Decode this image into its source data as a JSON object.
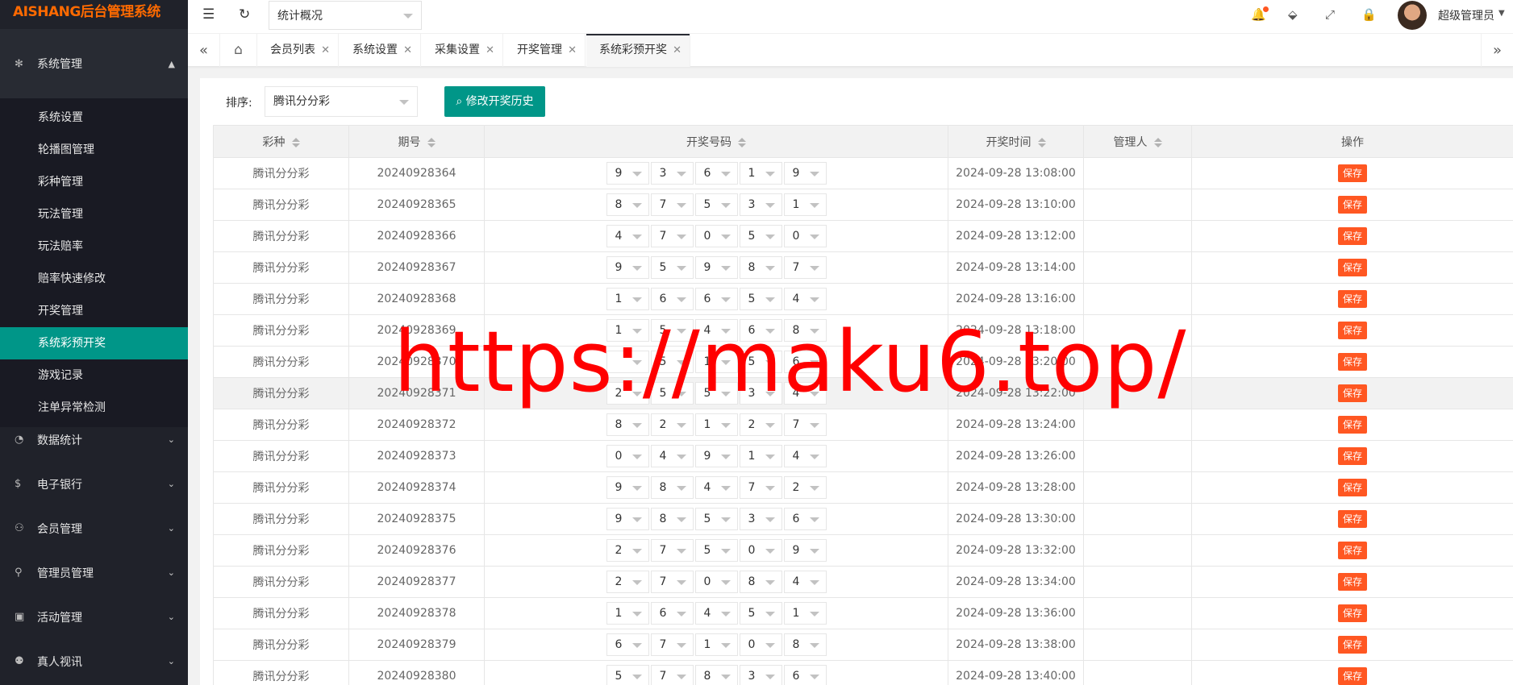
{
  "app": {
    "title": "AISHANG后台管理系统"
  },
  "topbar": {
    "select_value": "统计概况",
    "admin_name": "超级管理员"
  },
  "sidebar": {
    "open_group": {
      "label": "系统管理",
      "icon": "gear-icon"
    },
    "sub_items": [
      {
        "label": "系统设置"
      },
      {
        "label": "轮播图管理"
      },
      {
        "label": "彩种管理"
      },
      {
        "label": "玩法管理"
      },
      {
        "label": "玩法赔率"
      },
      {
        "label": "赔率快速修改"
      },
      {
        "label": "开奖管理"
      },
      {
        "label": "系统彩预开奖",
        "active": true
      },
      {
        "label": "游戏记录"
      },
      {
        "label": "注单异常检测"
      }
    ],
    "groups": [
      {
        "label": "数据统计",
        "icon": "dashboard-icon"
      },
      {
        "label": "电子银行",
        "icon": "dollar-icon"
      },
      {
        "label": "会员管理",
        "icon": "users-icon"
      },
      {
        "label": "管理员管理",
        "icon": "user-icon"
      },
      {
        "label": "活动管理",
        "icon": "gift-icon"
      },
      {
        "label": "真人视讯",
        "icon": "group-icon"
      }
    ]
  },
  "tabs": [
    {
      "label": "会员列表"
    },
    {
      "label": "系统设置"
    },
    {
      "label": "采集设置"
    },
    {
      "label": "开奖管理"
    },
    {
      "label": "系统彩预开奖",
      "active": true
    }
  ],
  "filter": {
    "label": "排序:",
    "select_value": "腾讯分分彩",
    "history_button": "修改开奖历史"
  },
  "table": {
    "headers": [
      "彩种",
      "期号",
      "开奖号码",
      "开奖时间",
      "管理人",
      "操作"
    ],
    "save_label": "保存",
    "rows": [
      {
        "game": "腾讯分分彩",
        "issue": "20240928364",
        "numbers": [
          "9",
          "3",
          "6",
          "1",
          "9"
        ],
        "time": "2024-09-28 13:08:00",
        "admin": ""
      },
      {
        "game": "腾讯分分彩",
        "issue": "20240928365",
        "numbers": [
          "8",
          "7",
          "5",
          "3",
          "1"
        ],
        "time": "2024-09-28 13:10:00",
        "admin": ""
      },
      {
        "game": "腾讯分分彩",
        "issue": "20240928366",
        "numbers": [
          "4",
          "7",
          "0",
          "5",
          "0"
        ],
        "time": "2024-09-28 13:12:00",
        "admin": ""
      },
      {
        "game": "腾讯分分彩",
        "issue": "20240928367",
        "numbers": [
          "9",
          "5",
          "9",
          "8",
          "7"
        ],
        "time": "2024-09-28 13:14:00",
        "admin": ""
      },
      {
        "game": "腾讯分分彩",
        "issue": "20240928368",
        "numbers": [
          "1",
          "6",
          "6",
          "5",
          "4"
        ],
        "time": "2024-09-28 13:16:00",
        "admin": ""
      },
      {
        "game": "腾讯分分彩",
        "issue": "20240928369",
        "numbers": [
          "1",
          "5",
          "4",
          "6",
          "8"
        ],
        "time": "2024-09-28 13:18:00",
        "admin": ""
      },
      {
        "game": "腾讯分分彩",
        "issue": "20240928370",
        "numbers": [
          "",
          "5",
          "1",
          "5",
          "6"
        ],
        "time": "2024-09-28 13:20:00",
        "admin": ""
      },
      {
        "game": "腾讯分分彩",
        "issue": "20240928371",
        "numbers": [
          "2",
          "5",
          "5",
          "3",
          "4"
        ],
        "time": "2024-09-28 13:22:00",
        "admin": "",
        "highlight": true
      },
      {
        "game": "腾讯分分彩",
        "issue": "20240928372",
        "numbers": [
          "8",
          "2",
          "1",
          "2",
          "7"
        ],
        "time": "2024-09-28 13:24:00",
        "admin": ""
      },
      {
        "game": "腾讯分分彩",
        "issue": "20240928373",
        "numbers": [
          "0",
          "4",
          "9",
          "1",
          "4"
        ],
        "time": "2024-09-28 13:26:00",
        "admin": ""
      },
      {
        "game": "腾讯分分彩",
        "issue": "20240928374",
        "numbers": [
          "9",
          "8",
          "4",
          "7",
          "2"
        ],
        "time": "2024-09-28 13:28:00",
        "admin": ""
      },
      {
        "game": "腾讯分分彩",
        "issue": "20240928375",
        "numbers": [
          "9",
          "8",
          "5",
          "3",
          "6"
        ],
        "time": "2024-09-28 13:30:00",
        "admin": ""
      },
      {
        "game": "腾讯分分彩",
        "issue": "20240928376",
        "numbers": [
          "2",
          "7",
          "5",
          "0",
          "9"
        ],
        "time": "2024-09-28 13:32:00",
        "admin": ""
      },
      {
        "game": "腾讯分分彩",
        "issue": "20240928377",
        "numbers": [
          "2",
          "7",
          "0",
          "8",
          "4"
        ],
        "time": "2024-09-28 13:34:00",
        "admin": ""
      },
      {
        "game": "腾讯分分彩",
        "issue": "20240928378",
        "numbers": [
          "1",
          "6",
          "4",
          "5",
          "1"
        ],
        "time": "2024-09-28 13:36:00",
        "admin": ""
      },
      {
        "game": "腾讯分分彩",
        "issue": "20240928379",
        "numbers": [
          "6",
          "7",
          "1",
          "0",
          "8"
        ],
        "time": "2024-09-28 13:38:00",
        "admin": ""
      },
      {
        "game": "腾讯分分彩",
        "issue": "20240928380",
        "numbers": [
          "5",
          "7",
          "8",
          "3",
          "6"
        ],
        "time": "2024-09-28 13:40:00",
        "admin": ""
      }
    ]
  },
  "watermark": "https://maku6.top/",
  "colors": {
    "accent": "#009688",
    "danger": "#ff5722",
    "sidebar": "#20222a",
    "logo": "#ff6a00"
  }
}
